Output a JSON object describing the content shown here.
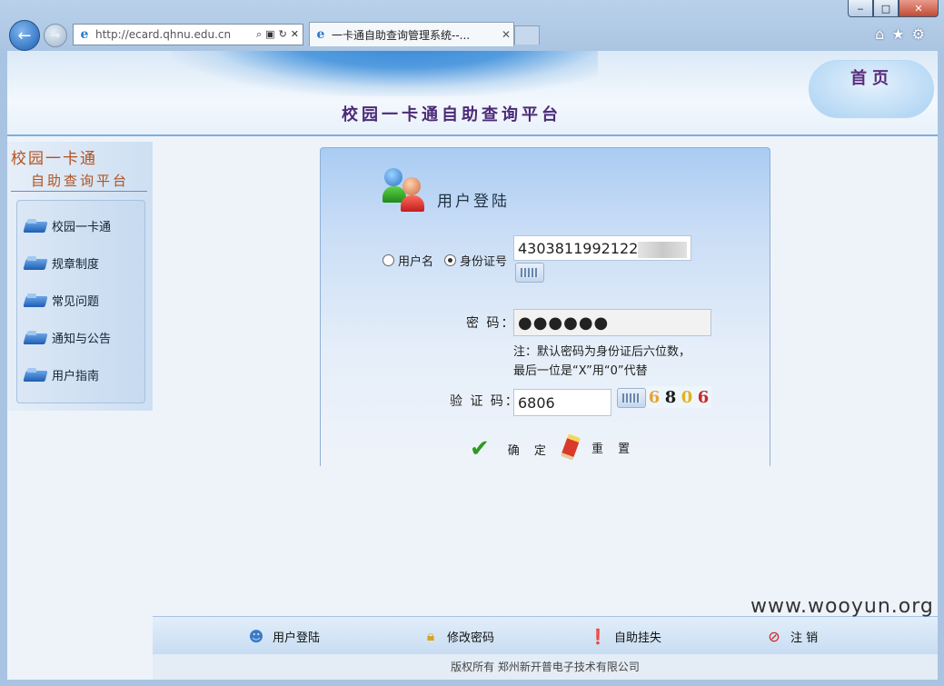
{
  "browser": {
    "url": "http://ecard.qhnu.edu.cn",
    "tab_title": "一卡通自助查询管理系统--...",
    "window_min": "‒",
    "window_max": "□",
    "window_close": "✕",
    "back_glyph": "←",
    "forward_glyph": "→",
    "ie_glyph": "e",
    "tab_close": "✕"
  },
  "banner": {
    "title": "校园一卡通自助查询平台",
    "home_label": "首页"
  },
  "sidebar": {
    "title_line1": "校园一卡通",
    "title_line2": "自助查询平台",
    "items": [
      {
        "label": "校园一卡通"
      },
      {
        "label": "规章制度"
      },
      {
        "label": "常见问题"
      },
      {
        "label": "通知与公告"
      },
      {
        "label": "用户指南"
      }
    ]
  },
  "login": {
    "heading": "用户登陆",
    "radio_username": "用户名",
    "radio_idcard": "身份证号",
    "selected_mode": "身份证号",
    "id_value": "4303811992122",
    "password_label": "密 码：",
    "password_value": "●●●●●●",
    "note_line1": "注：默认密码为身份证后六位数，",
    "note_line2": "最后一位是“X”用“0”代替",
    "captcha_label": "验 证 码：",
    "captcha_value": "6806",
    "captcha_image_chars": [
      "6",
      "8",
      "0",
      "6"
    ],
    "captcha_colors": [
      "#e8a23a",
      "#1a1a1a",
      "#e3b21e",
      "#c8282a"
    ],
    "confirm_label": "确 定",
    "reset_label": "重 置"
  },
  "footer_nav": [
    {
      "label": "用户登陆",
      "icon": "user-icon"
    },
    {
      "label": "修改密码",
      "icon": "lock-icon"
    },
    {
      "label": "自助挂失",
      "icon": "alert-icon"
    },
    {
      "label": "注 销",
      "icon": "logout-icon"
    }
  ],
  "copyright": "版权所有 郑州新开普电子技术有限公司",
  "watermark": "www.wooyun.org"
}
